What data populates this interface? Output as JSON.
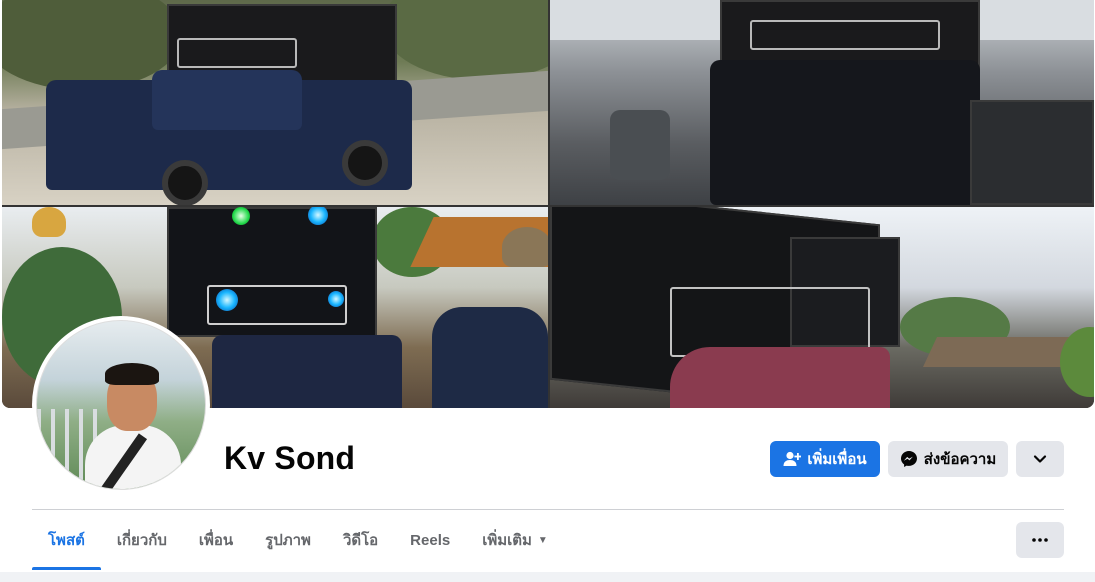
{
  "profile": {
    "name": "Kv Sond"
  },
  "actions": {
    "add_friend_label": "เพิ่มเพื่อน",
    "message_label": "ส่งข้อความ",
    "more_icon": "chevron-down-icon"
  },
  "tabs": [
    {
      "label": "โพสต์",
      "active": true
    },
    {
      "label": "เกี่ยวกับ",
      "active": false
    },
    {
      "label": "เพื่อน",
      "active": false
    },
    {
      "label": "รูปภาพ",
      "active": false
    },
    {
      "label": "วิดีโอ",
      "active": false
    },
    {
      "label": "Reels",
      "active": false
    },
    {
      "label": "เพิ่มเติม",
      "active": false
    }
  ],
  "colors": {
    "accent": "#1b74e4",
    "button_secondary": "#e4e6eb",
    "text_primary": "#050505",
    "text_secondary": "#65676b"
  }
}
